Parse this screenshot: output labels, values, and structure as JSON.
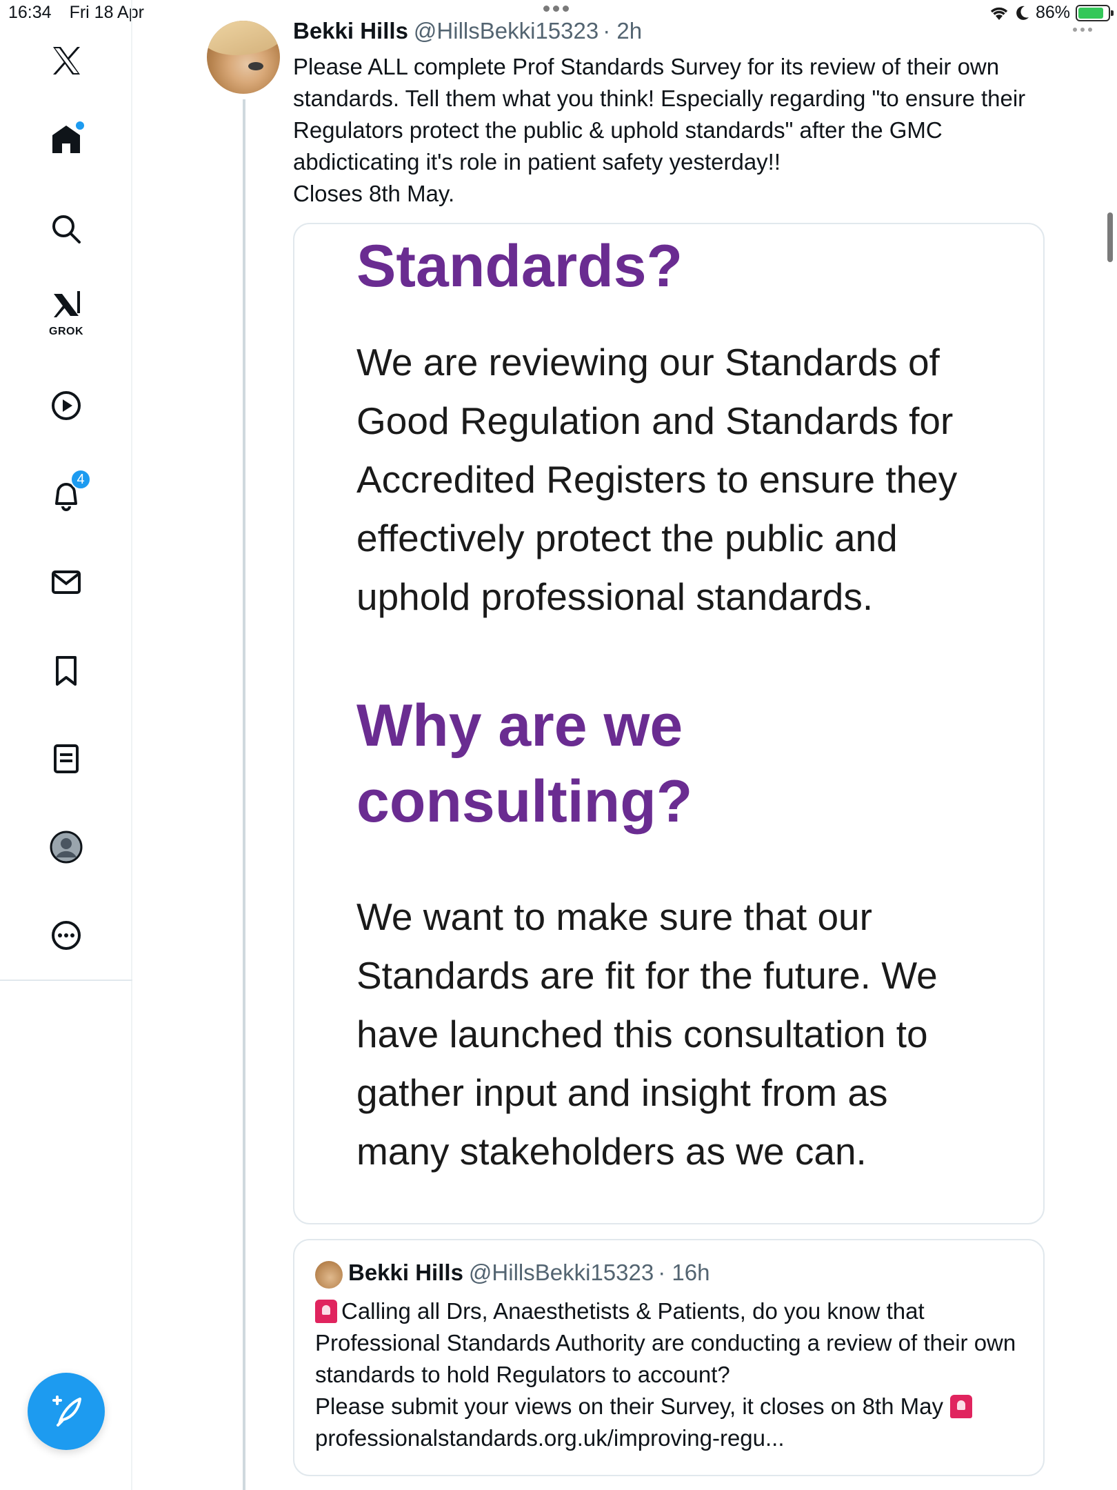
{
  "status_bar": {
    "time": "16:34",
    "date": "Fri 18 Apr",
    "battery": "86%",
    "battery_level": 0.86
  },
  "sidebar": {
    "items": [
      {
        "icon": "x-logo-icon",
        "label": "X"
      },
      {
        "icon": "home-icon",
        "label": "Home"
      },
      {
        "icon": "search-icon",
        "label": "Explore"
      },
      {
        "icon": "grok-icon",
        "label": "GROK"
      },
      {
        "icon": "video-play-icon",
        "label": "Video"
      },
      {
        "icon": "bell-icon",
        "label": "Notifications",
        "badge": "4"
      },
      {
        "icon": "mail-icon",
        "label": "Messages"
      },
      {
        "icon": "bookmark-icon",
        "label": "Bookmarks"
      },
      {
        "icon": "list-icon",
        "label": "Lists"
      },
      {
        "icon": "profile-icon",
        "label": "Profile"
      },
      {
        "icon": "more-icon",
        "label": "More"
      }
    ],
    "compose_icon": "compose-icon"
  },
  "tweet": {
    "name": "Bekki Hills",
    "handle": "@HillsBekki15323",
    "time": "· 2h",
    "text": "Please ALL complete Prof Standards Survey for its review of their own standards. Tell them what you think! Especially regarding \"to ensure their Regulators protect the public & uphold standards\" after the GMC abdicticating it's role in patient safety yesterday!!\nCloses 8th May.",
    "image": {
      "heading1": "Standards?",
      "body1": "We are reviewing our Standards of\nGood Regulation and Standards for\nAccredited Registers to ensure they\neffectively protect the public and\nuphold professional standards.",
      "heading2": "Why are we\nconsulting?",
      "body2": "We want to make sure that our\nStandards are fit for the future. We\nhave launched this consultation to\ngather input and insight from as\nmany stakeholders as we can.",
      "accent_color": "#6a2c91"
    }
  },
  "quote": {
    "name": "Bekki Hills",
    "handle": "@HillsBekki15323",
    "time": "· 16h",
    "text_line1": "Calling all Drs, Anaesthetists & Patients, do you know that Professional Standards Authority are conducting a review of their own standards to hold Regulators to account?",
    "text_line2": "Please submit your views on their Survey, it closes on 8th May",
    "link": "professionalstandards.org.uk/improving-regu..."
  }
}
